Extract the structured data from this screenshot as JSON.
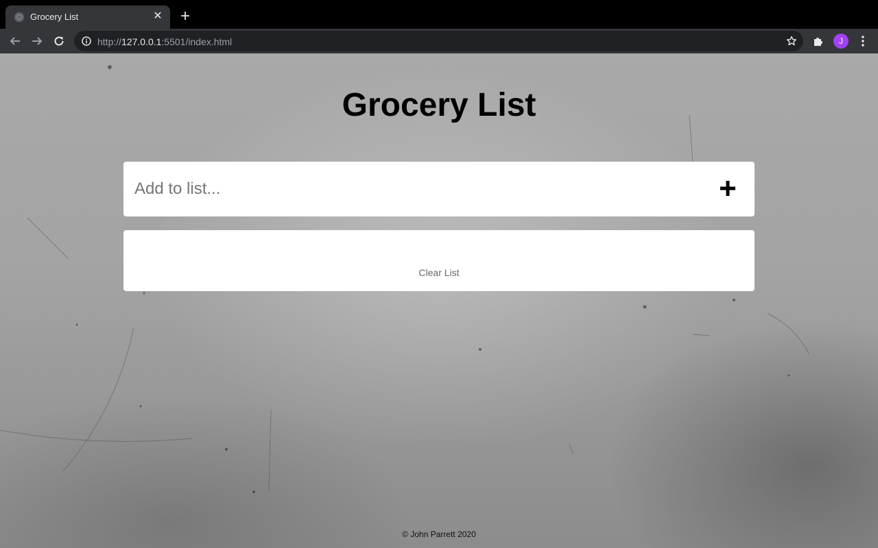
{
  "browser": {
    "tab_title": "Grocery List",
    "tab_close": "✕",
    "new_tab": "+",
    "url_scheme": "http://",
    "url_host": "127.0.0.1",
    "url_rest": ":5501/index.html",
    "avatar_initial": "J",
    "colors": {
      "avatar": "#a142f4",
      "toolbar": "#35363a",
      "omnibox": "#202124"
    }
  },
  "page": {
    "title": "Grocery List",
    "input_placeholder": "Add to list...",
    "input_value": "",
    "add_icon": "plus-icon",
    "list_items": [],
    "clear_label": "Clear List",
    "footer": "© John Parrett 2020"
  }
}
